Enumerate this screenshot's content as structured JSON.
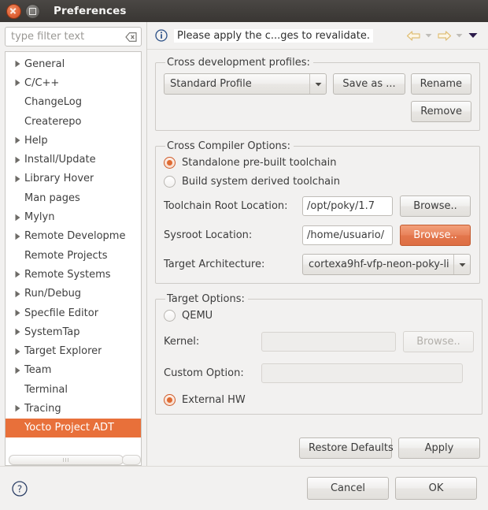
{
  "window": {
    "title": "Preferences",
    "close_icon": "close-icon",
    "maximize_icon": "maximize-icon"
  },
  "sidebar": {
    "filter": {
      "value": "",
      "placeholder": "type filter text",
      "clear_icon": "clear-icon"
    },
    "items": [
      {
        "label": "General",
        "expandable": true,
        "selected": false
      },
      {
        "label": "C/C++",
        "expandable": true,
        "selected": false
      },
      {
        "label": "ChangeLog",
        "expandable": false,
        "selected": false
      },
      {
        "label": "Createrepo",
        "expandable": false,
        "selected": false
      },
      {
        "label": "Help",
        "expandable": true,
        "selected": false
      },
      {
        "label": "Install/Update",
        "expandable": true,
        "selected": false
      },
      {
        "label": "Library Hover",
        "expandable": true,
        "selected": false
      },
      {
        "label": "Man pages",
        "expandable": false,
        "selected": false
      },
      {
        "label": "Mylyn",
        "expandable": true,
        "selected": false
      },
      {
        "label": "Remote Developme",
        "expandable": true,
        "selected": false
      },
      {
        "label": "Remote Projects",
        "expandable": false,
        "selected": false
      },
      {
        "label": "Remote Systems",
        "expandable": true,
        "selected": false
      },
      {
        "label": "Run/Debug",
        "expandable": true,
        "selected": false
      },
      {
        "label": "Specfile Editor",
        "expandable": true,
        "selected": false
      },
      {
        "label": "SystemTap",
        "expandable": true,
        "selected": false
      },
      {
        "label": "Target Explorer",
        "expandable": true,
        "selected": false
      },
      {
        "label": "Team",
        "expandable": true,
        "selected": false
      },
      {
        "label": "Terminal",
        "expandable": false,
        "selected": false
      },
      {
        "label": "Tracing",
        "expandable": true,
        "selected": false
      },
      {
        "label": "Yocto Project ADT",
        "expandable": false,
        "selected": true
      }
    ],
    "selection_color": "#e8703a",
    "scrollbar_icon": "horizontal-scrollbar"
  },
  "message_bar": {
    "icon": "info-icon",
    "text": "Please apply the c...ges to revalidate.",
    "back_icon": "back-arrow-icon",
    "back_dropdown_icon": "chevron-down-icon",
    "forward_icon": "forward-arrow-icon",
    "forward_dropdown_icon": "chevron-down-icon",
    "menu_icon": "chevron-down-icon"
  },
  "profiles": {
    "legend": "Cross development profiles:",
    "selected": "Standard Profile",
    "dropdown_icon": "chevron-down-icon",
    "save_as_label": "Save as ...",
    "rename_label": "Rename",
    "remove_label": "Remove"
  },
  "compiler": {
    "legend": "Cross Compiler Options:",
    "standalone_label": "Standalone pre-built toolchain",
    "standalone_selected": true,
    "build_system_label": "Build system derived toolchain",
    "build_system_selected": false,
    "toolchain_root_label": "Toolchain Root Location:",
    "toolchain_root_value": "/opt/poky/1.7",
    "toolchain_browse_label": "Browse..",
    "sysroot_label": "Sysroot Location:",
    "sysroot_value": "/home/usuario/",
    "sysroot_browse_label": "Browse..",
    "sysroot_browse_highlighted": true,
    "arch_label": "Target Architecture:",
    "arch_value": "cortexa9hf-vfp-neon-poky-li",
    "arch_dropdown_icon": "chevron-down-icon"
  },
  "target": {
    "legend": "Target Options:",
    "qemu_label": "QEMU",
    "qemu_selected": false,
    "kernel_label": "Kernel:",
    "kernel_value": "",
    "kernel_browse_label": "Browse..",
    "custom_option_label": "Custom Option:",
    "custom_option_value": "",
    "external_hw_label": "External HW",
    "external_hw_selected": true
  },
  "actions": {
    "restore_defaults_label": "Restore Defaults",
    "apply_label": "Apply"
  },
  "footer": {
    "help_icon": "help-icon",
    "cancel_label": "Cancel",
    "ok_label": "OK"
  }
}
